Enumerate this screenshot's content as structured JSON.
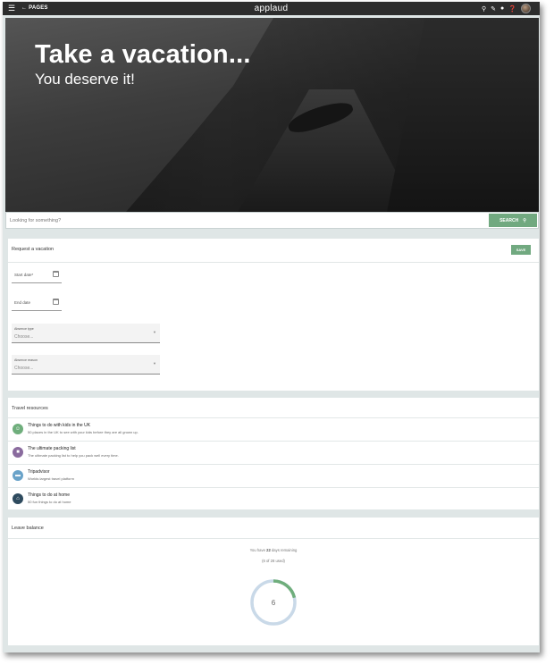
{
  "topbar": {
    "back_label": "PAGES",
    "app_name": "applaud",
    "icons": [
      "search-icon",
      "pencil-icon",
      "bell-icon",
      "help-icon"
    ]
  },
  "hero": {
    "title": "Take a vacation...",
    "subtitle": "You deserve it!"
  },
  "search": {
    "placeholder": "Looking for something?",
    "button_label": "SEARCH"
  },
  "request": {
    "title": "Request a vacation",
    "save_label": "SAVE",
    "start_label": "Start date*",
    "end_label": "End date",
    "absence_type_label": "Absence type",
    "absence_type_value": "Choose...",
    "absence_reason_label": "Absence reason",
    "absence_reason_value": "Choose..."
  },
  "resources": {
    "title": "Travel resources",
    "items": [
      {
        "title": "Things to do with kids in the UK",
        "subtitle": "50 places in the UK to see with your kids before they are all grown up.",
        "color": "#6fae7c",
        "icon": "smile-icon"
      },
      {
        "title": "The ultimate packing list",
        "subtitle": "The ultimate packing list to help you pack well every time.",
        "color": "#8a6b9e",
        "icon": "suitcase-icon"
      },
      {
        "title": "Tripadvisor",
        "subtitle": "Worlds largest travel platform",
        "color": "#6aa3c9",
        "icon": "bed-icon"
      },
      {
        "title": "Things to do at home",
        "subtitle": "50 fun things to do at home",
        "color": "#2e4a5e",
        "icon": "home-icon"
      }
    ]
  },
  "balance": {
    "title": "Leave balance",
    "line_prefix": "You have",
    "remaining": "22",
    "line_suffix": "days remaining",
    "used_text": "(6 of 28 used)",
    "center_value": "6",
    "used_fraction": 0.214,
    "used_color": "#6fae7c",
    "track_color": "#c9d9e8"
  }
}
